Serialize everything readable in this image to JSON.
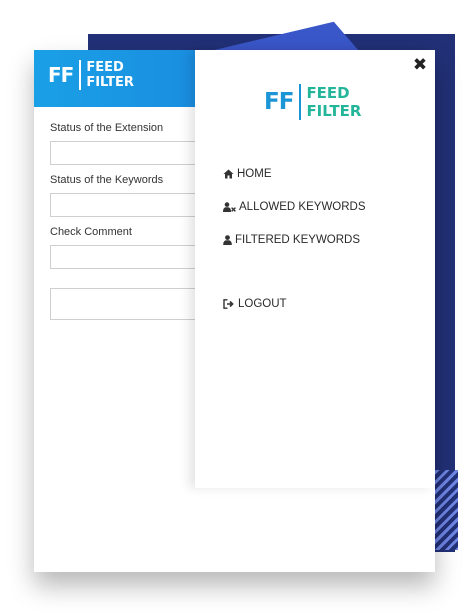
{
  "brand": {
    "initials": "FF",
    "word1": "FEED",
    "word2": "FILTER"
  },
  "form": {
    "fields": [
      {
        "label": "Status of the Extension",
        "value": ""
      },
      {
        "label": "Status of the Keywords",
        "value": ""
      },
      {
        "label": "Check Comment",
        "value": ""
      }
    ],
    "extra_value": ""
  },
  "sidebar": {
    "close_symbol": "✖",
    "menu": [
      {
        "label": "HOME",
        "icon": "home-icon"
      },
      {
        "label": "ALLOWED KEYWORDS",
        "icon": "user-x-icon"
      },
      {
        "label": "FILTERED KEYWORDS",
        "icon": "user-icon"
      },
      {
        "label": "LOGOUT",
        "icon": "logout-icon"
      }
    ]
  },
  "colors": {
    "header_blue": "#1aa0e6",
    "brand_blue": "#1b95d6",
    "brand_teal": "#22b59a",
    "navy": "#223077",
    "triangle_blue": "#3a57c9"
  }
}
